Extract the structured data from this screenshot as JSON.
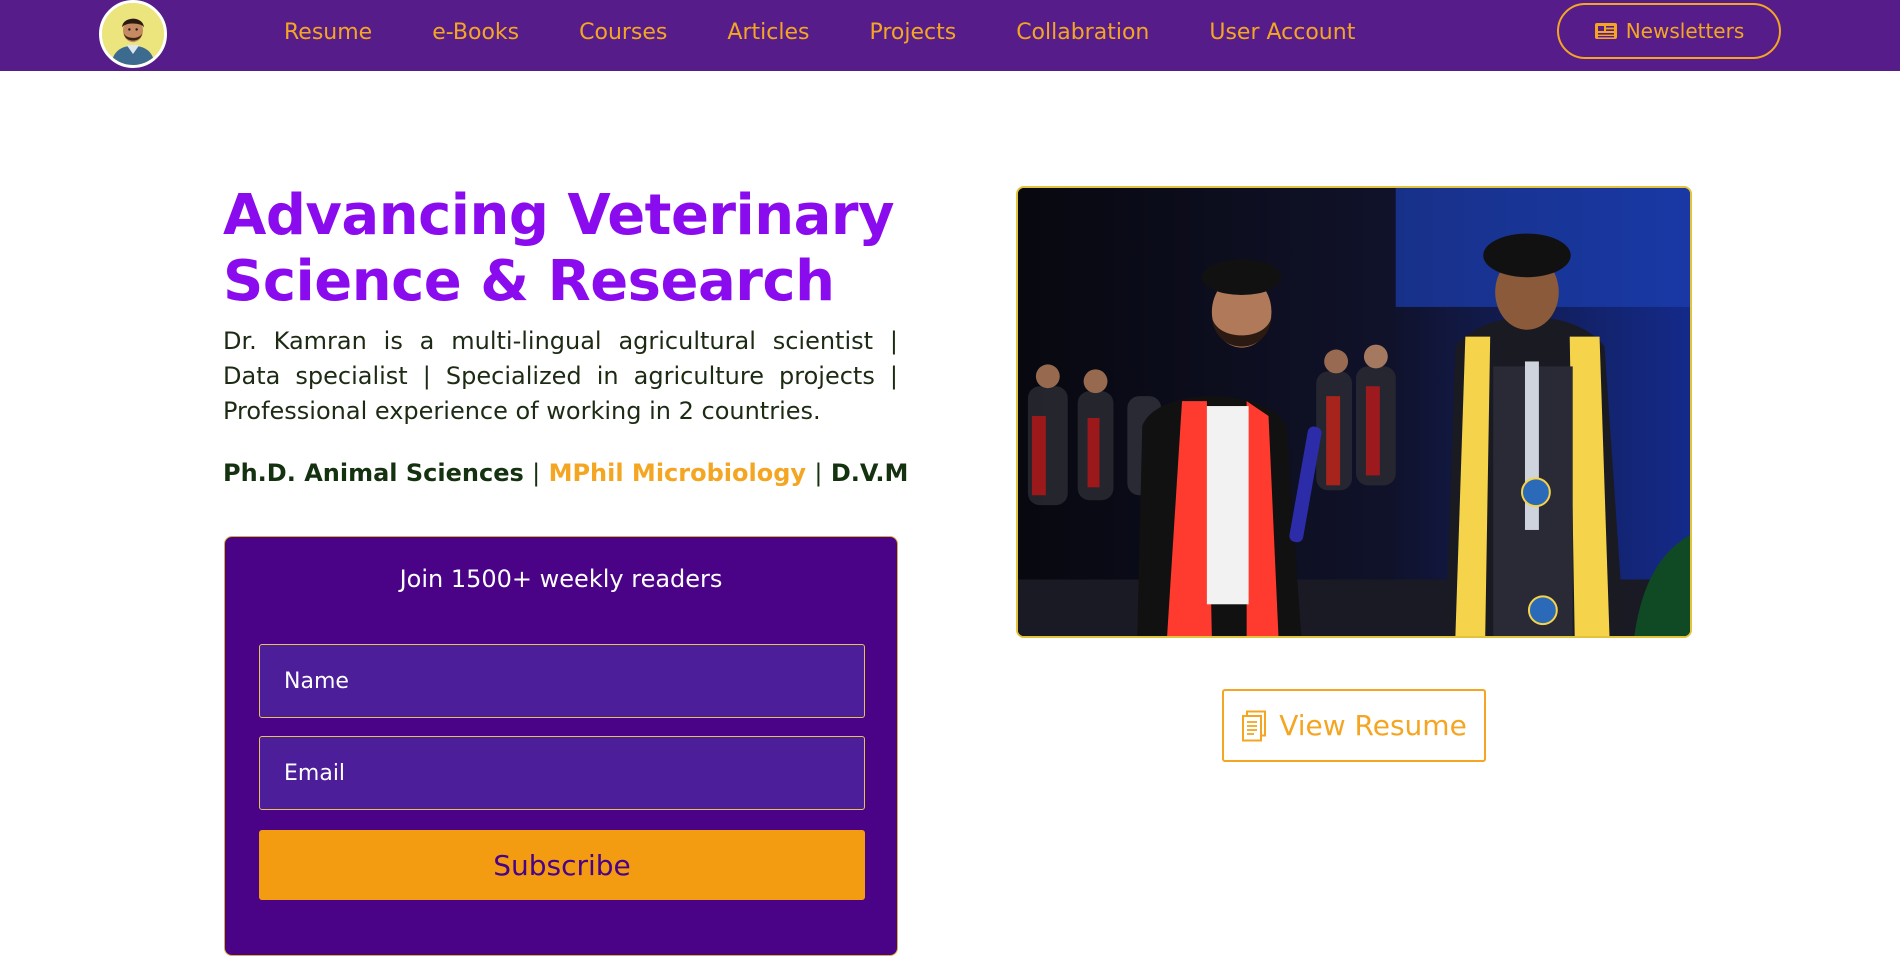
{
  "nav": {
    "items": [
      "Resume",
      "e-Books",
      "Courses",
      "Articles",
      "Projects",
      "Collabration",
      "User Account"
    ],
    "newsletter_label": "Newsletters",
    "newsletter_icon": "newspaper-icon",
    "avatar_icon": "profile-avatar"
  },
  "hero": {
    "title_line1": "Advancing Veterinary",
    "title_line2": "Science & Research",
    "description": "Dr. Kamran is a multi-lingual agricultural scientist | Data specialist | Specialized in agriculture projects | Professional experience  of working in 2 countries.",
    "qualifications": {
      "first": "Ph.D. Animal Sciences",
      "separator": "|",
      "second": "MPhil Microbiology",
      "third": "D.V.M"
    }
  },
  "subscribe": {
    "title": "Join 1500+ weekly readers",
    "name_placeholder": "Name",
    "email_placeholder": "Email",
    "button_label": "Subscribe"
  },
  "resume_button": {
    "label": "View Resume",
    "icon": "document-icon"
  },
  "colors": {
    "nav_background": "#561d8a",
    "accent_gold": "#f4a623",
    "title_purple": "#8b0bef",
    "card_background": "#4a0387",
    "subscribe_button": "#f39c12"
  }
}
